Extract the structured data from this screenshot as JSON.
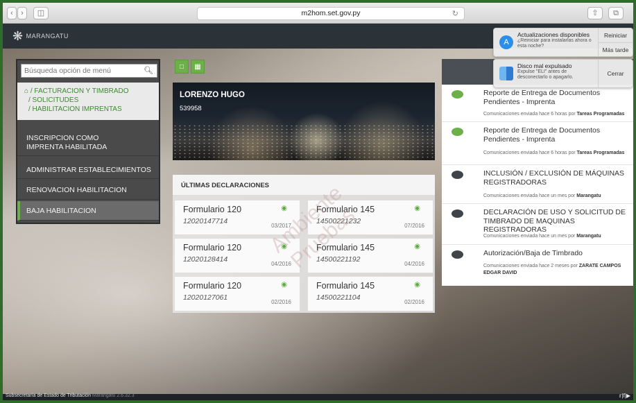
{
  "browser": {
    "url": "m2hom.set.gov.py",
    "back_icon": "chevron-left-icon",
    "forward_icon": "chevron-right-icon"
  },
  "header": {
    "logo_text": "MARANGATU"
  },
  "sidebar": {
    "search_placeholder": "Búsqueda opción de menú",
    "breadcrumb": [
      "/ FACTURACION Y TIMBRADO",
      "/ SOLICITUDES",
      "/ HABILITACION IMPRENTAS"
    ],
    "items": [
      {
        "label": "INSCRIPCION COMO IMPRENTA HABILITADA"
      },
      {
        "label": "ADMINISTRAR ESTABLECIMIENTOS"
      },
      {
        "label": "RENOVACION HABILITACION"
      },
      {
        "label": "BAJA HABILITACION"
      }
    ]
  },
  "profile": {
    "name": "LORENZO HUGO",
    "id": "539958"
  },
  "declarations": {
    "header": "ÚLTIMAS DECLARACIONES",
    "items": [
      {
        "form": "Formulario 120",
        "number": "12020147714",
        "date": "03/2017"
      },
      {
        "form": "Formulario 145",
        "number": "14500221232",
        "date": "07/2016"
      },
      {
        "form": "Formulario 120",
        "number": "12020128414",
        "date": "04/2016"
      },
      {
        "form": "Formulario 145",
        "number": "14500221192",
        "date": "04/2016"
      },
      {
        "form": "Formulario 120",
        "number": "12020127061",
        "date": "02/2016"
      },
      {
        "form": "Formulario 145",
        "number": "14500221104",
        "date": "02/2016"
      }
    ]
  },
  "notifications": [
    {
      "title": "Reporte de Entrega de Documentos Pendientes - Imprenta",
      "meta": "Comunicaciones enviada hace 6 horas por",
      "author": "Tareas Programadas",
      "color": "#6db04a"
    },
    {
      "title": "Reporte de Entrega de Documentos Pendientes - Imprenta",
      "meta": "Comunicaciones enviada hace 6 horas por",
      "author": "Tareas Programadas",
      "color": "#6db04a"
    },
    {
      "title": "INCLUSIÓN / EXCLUSIÓN DE MÁQUINAS REGISTRADORAS",
      "meta": "Comunicaciones enviada hace un mes por",
      "author": "Marangatu",
      "color": "#3f4449"
    },
    {
      "title": "DECLARACIÓN DE USO Y SOLICITUD DE TIMBRADO DE MAQUINAS REGISTRADORAS",
      "meta": "Comunicaciones enviada hace un mes por",
      "author": "Marangatu",
      "color": "#3f4449"
    },
    {
      "title": "Autorización/Baja de Timbrado",
      "meta": "Comunicaciones enviada hace 2 meses por",
      "author": "ZARATE CAMPOS EDGAR DAVID",
      "color": "#3f4449"
    }
  ],
  "mac_notifications": {
    "update": {
      "title": "Actualizaciones disponibles",
      "body": "¿Reiniciar para instalarlas ahora o esta noche?",
      "action1": "Reiniciar",
      "action2": "Más tarde"
    },
    "disk": {
      "title": "Disco mal expulsado",
      "body": "Expulse \"ELI\" antes de desconectarlo o apagarlo.",
      "action": "Cerrar"
    }
  },
  "watermark": {
    "line1": "Ambiente",
    "line2": "Pruebas"
  },
  "footer": {
    "org": "Subsecretaría de Estado de Tributación",
    "version": "Marangatu 2.6.32.3"
  },
  "colors": {
    "accent_green": "#6db04a",
    "header_dark": "#2b3238",
    "menu_dark": "#4a4a4a"
  }
}
